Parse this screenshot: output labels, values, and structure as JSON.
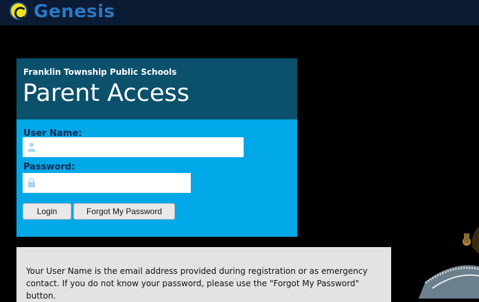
{
  "brand": {
    "logo_text": "Genesis"
  },
  "header": {
    "school": "Franklin Township Public Schools",
    "title": "Parent Access"
  },
  "form": {
    "username_label": "User Name:",
    "username_value": "",
    "password_label": "Password:",
    "password_value": "",
    "login_label": "Login",
    "forgot_label": "Forgot My Password"
  },
  "info": {
    "text": "Your User Name is the email address provided during registration or as emergency contact. If you do not know your password, please use the \"Forgot My Password\" button."
  },
  "colors": {
    "topbar": "#0b1b33",
    "header_panel": "#0b516c",
    "form_panel": "#00a8e8",
    "info_panel": "#e3e3e3"
  }
}
